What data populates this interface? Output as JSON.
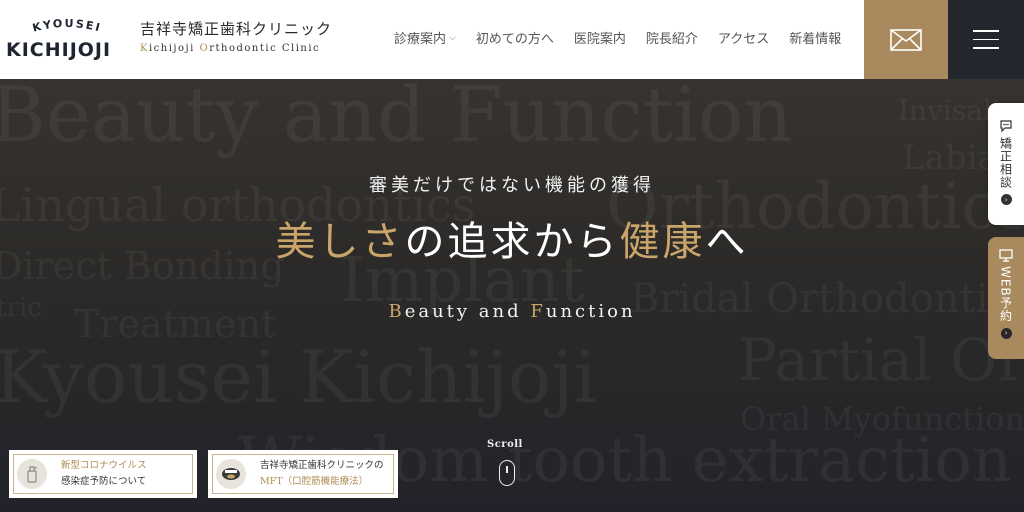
{
  "logo": {
    "arc_text": "KYOUSEI",
    "main_text": "KICHIJOJI"
  },
  "clinic": {
    "name": "吉祥寺矯正歯科クリニック",
    "sub_k": "K",
    "sub_1": "ichijoji ",
    "sub_o": "O",
    "sub_2": "rthodontic Clinic"
  },
  "nav": {
    "items": [
      {
        "label": "診療案内",
        "has_dropdown": true
      },
      {
        "label": "初めての方へ"
      },
      {
        "label": "医院案内"
      },
      {
        "label": "院長紹介"
      },
      {
        "label": "アクセス"
      },
      {
        "label": "新着情報"
      }
    ]
  },
  "hero": {
    "background_words": [
      "Beauty and Function",
      "Invisalign",
      "Labial",
      "Lingual orthodontics",
      "Orthodontics",
      "Direct Bonding",
      "Implant",
      "Bridal Orthodontics",
      "Treatment",
      "Kyousei Kichijoji",
      "Partial Orthodontics",
      "Oral Myofunctional",
      "Wisdom tooth extraction",
      "tric"
    ],
    "subtitle": "審美だけではない機能の獲得",
    "title_gold_1": "美しさ",
    "title_plain_1": "の追求から",
    "title_gold_2": "健康",
    "title_plain_2": "へ",
    "en_b": "B",
    "en_1": "eauty and ",
    "en_f": "F",
    "en_2": "unction",
    "scroll_label": "Scroll"
  },
  "cards": [
    {
      "line1": "新型コロナウイルス",
      "line2": "感染症予防について",
      "icon": "sanitizer-icon"
    },
    {
      "line1": "吉祥寺矯正歯科クリニックの",
      "line2_gold": "MFT",
      "line2_rest": "（口腔筋機能療法）",
      "icon": "mouth-icon"
    }
  ],
  "side_tabs": {
    "consult": {
      "label": "矯正相談",
      "icon": "chat-icon"
    },
    "web": {
      "label": "WEB予約",
      "icon": "monitor-icon"
    }
  },
  "colors": {
    "gold": "#c9a56a",
    "gold_dark": "#a88a5e",
    "navy": "#24262e"
  }
}
